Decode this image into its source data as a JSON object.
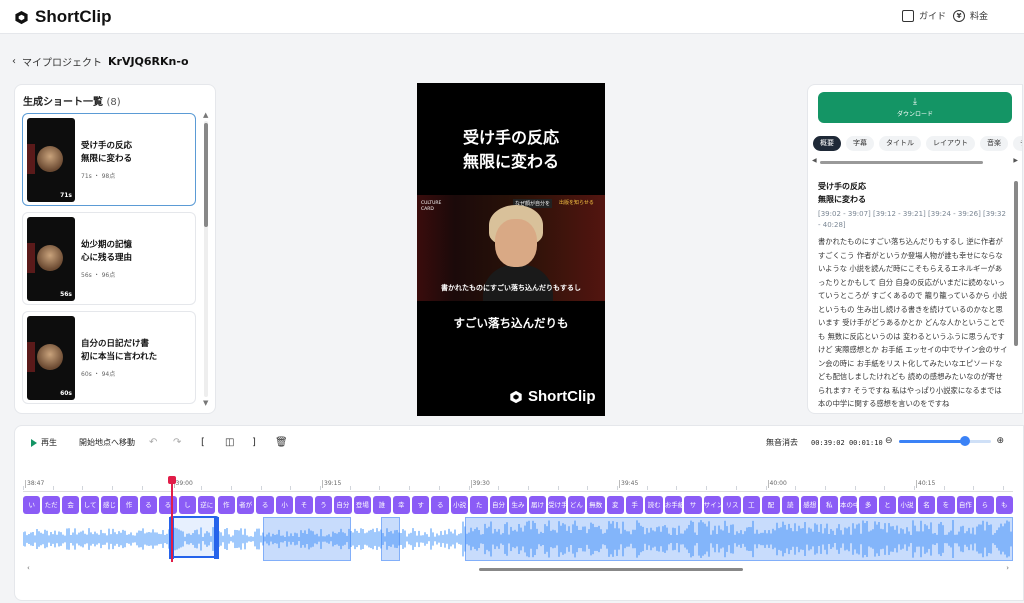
{
  "header": {
    "brand": "ShortClip",
    "guide_label": "ガイド",
    "pricing_label": "料金"
  },
  "breadcrumb": {
    "back_label": "マイプロジェクト",
    "project_id": "KrVJQ6RKn-o"
  },
  "shorts_panel": {
    "title": "生成ショート一覧",
    "count": "(8)",
    "items": [
      {
        "title": "受け手の反応\n無限に変わる",
        "meta": "71s ・ 98点",
        "duration": "71s"
      },
      {
        "title": "幼少期の記憶\n心に残る理由",
        "meta": "56s ・ 96点",
        "duration": "56s"
      },
      {
        "title": "自分の日記だけ書\n初に本当に言われた",
        "meta": "60s ・ 94点",
        "duration": "60s"
      }
    ]
  },
  "video": {
    "title": "受け手の反応\n無限に変わる",
    "frame_label": "なぜ顔が自分を",
    "frame_label2": "出版を知らせる",
    "frame_card": "CULTURE\nCARD",
    "frame_subtitle": "書かれたものにすごい落ち込んだりもするし",
    "caption": "すごい落ち込んだりも",
    "brand": "ShortClip"
  },
  "detail_panel": {
    "download_label": "ダウンロード",
    "tabs": [
      "概要",
      "字幕",
      "タイトル",
      "レイアウト",
      "音楽",
      "テキス"
    ],
    "active_tab": "概要",
    "title": "受け手の反応\n無限に変わる",
    "times": "[39:02 - 39:07] [39:12 - 39:21] [39:24 - 39:26] [39:32 - 40:28]",
    "body": "書かれたものにすごい落ち込んだりもするし 逆に作者がすごくこう 作者がというか登場人物が誰も幸せにならないような 小説を読んだ時にこそもらえるエネルギーがあったりとかもして 自分 自身の反応がいまだに読めないっていうところが すごくあるので 籠り籠っているから 小説というもの 生み出し続ける書きを続けているのかなと思います 受け手がどうあるかとか どんな人かということでも 無数に反応というのは 変わるというふうに思うんですけど 実際感想とか お手紙 エッセイの中でサイン会のサイン会の時に お手紙をリスト化してみたいなエピソードなども配信しましたけれども 読めの感想みたいなのが寄せられます? そうですね 私はやっぱり小説家になるまでは 本の中学に関する感想を言いのをですね"
  },
  "timeline": {
    "play_label": "再生",
    "jump_label": "開始地点へ移動",
    "silence_label": "無音消去",
    "current_time": "00:39:02",
    "total_time": "00:01:10",
    "zoom_level": 0.72,
    "ruler_ticks": [
      "38:47",
      "39:00",
      "39:15",
      "39:30",
      "39:45",
      "40:00",
      "40:15"
    ],
    "words": [
      "い",
      "ただ",
      "会",
      "して",
      "感じ",
      "作",
      "る",
      "る",
      "し",
      "逆に",
      "作",
      "者が",
      "る",
      "小",
      "そ",
      "う",
      "自分",
      "登場",
      "誰",
      "幸",
      "す",
      "る",
      "小説",
      "た",
      "自分",
      "生み",
      "届け",
      "受け手",
      "どん",
      "無数",
      "変",
      "手",
      "読む",
      "お手紙",
      "サ",
      "サイン会",
      "リス",
      "工",
      "配",
      "読",
      "感想",
      "私",
      "本の中",
      "多",
      "と",
      "小説",
      "名",
      "を",
      "自作",
      "ら",
      "も"
    ],
    "icons": {
      "undo": "undo-icon",
      "redo": "redo-icon"
    }
  },
  "colors": {
    "accent": "#149565",
    "word_chip": "#8b5cf6",
    "waveform": "#60a5fa",
    "playhead": "#e11d48"
  }
}
